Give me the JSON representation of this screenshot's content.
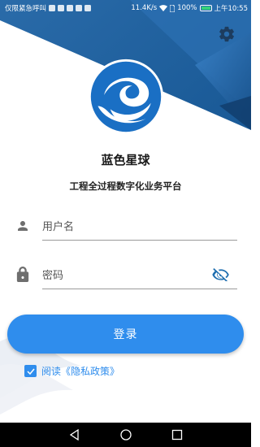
{
  "status_bar": {
    "carrier": "仅限紧急呼叫",
    "speed": "11.4K/s",
    "battery": "100%",
    "time": "上午10:55"
  },
  "app": {
    "title": "蓝色星球",
    "subtitle": "工程全过程数字化业务平台"
  },
  "form": {
    "username_placeholder": "用户名",
    "password_placeholder": "密码",
    "login_label": "登录",
    "privacy_label": "阅读《隐私政策》",
    "privacy_checked": true
  },
  "colors": {
    "brand_blue": "#2f8ded",
    "header_blue": "#1e6fb8",
    "logo_blue": "#1a6fc4"
  },
  "icons": {
    "settings": "gear-icon",
    "username": "person-icon",
    "password": "lock-icon",
    "visibility": "eye-slash-icon",
    "back": "triangle-back-icon",
    "home": "circle-home-icon",
    "recents": "square-recents-icon"
  }
}
